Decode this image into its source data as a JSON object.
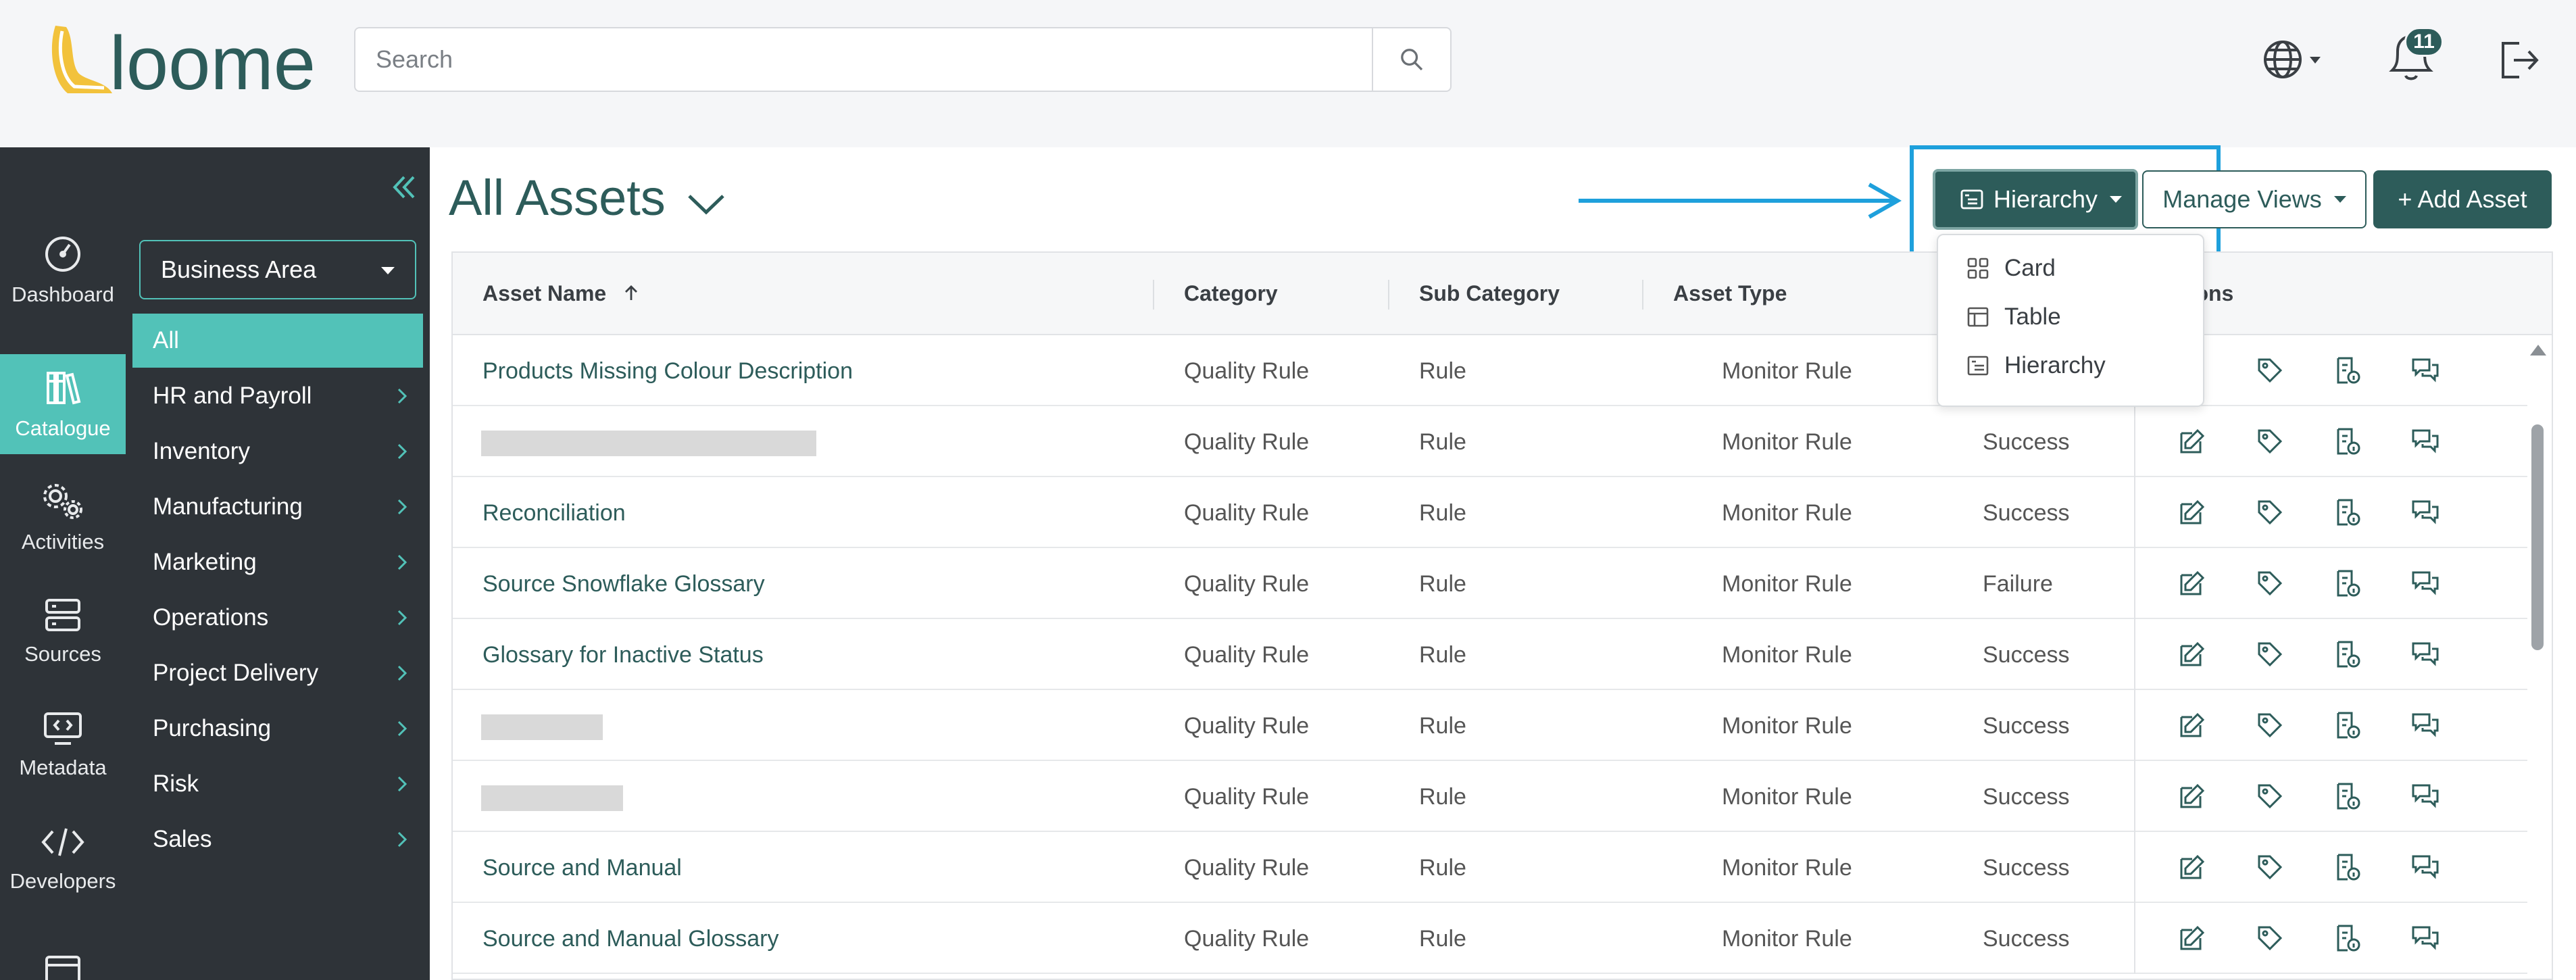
{
  "app": {
    "brand": "loome"
  },
  "header": {
    "search_placeholder": "Search",
    "notification_count": "11"
  },
  "leftnav": [
    {
      "label": "Dashboard",
      "icon": "gauge-icon"
    },
    {
      "label": "Catalogue",
      "icon": "books-icon",
      "active": true
    },
    {
      "label": "Activities",
      "icon": "gears-icon"
    },
    {
      "label": "Sources",
      "icon": "server-icon"
    },
    {
      "label": "Metadata",
      "icon": "monitor-code-icon"
    },
    {
      "label": "Developers",
      "icon": "code-icon"
    }
  ],
  "subpanel": {
    "select_label": "Business Area",
    "items": [
      "All",
      "HR and Payroll",
      "Inventory",
      "Manufacturing",
      "Marketing",
      "Operations",
      "Project Delivery",
      "Purchasing",
      "Risk",
      "Sales"
    ]
  },
  "main": {
    "title": "All Assets",
    "view_button": "Hierarchy",
    "manage_views": "Manage Views",
    "add_asset": "+ Add Asset",
    "dropdown": [
      "Card",
      "Table",
      "Hierarchy"
    ]
  },
  "table": {
    "headers": [
      "Asset Name",
      "Category",
      "Sub Category",
      "Asset Type",
      "Actions"
    ],
    "rows": [
      {
        "name": "Products Missing Colour Description",
        "category": "Quality Rule",
        "sub": "Rule",
        "type": "Monitor Rule",
        "status": ""
      },
      {
        "name": "",
        "category": "Quality Rule",
        "sub": "Rule",
        "type": "Monitor Rule",
        "status": "Success"
      },
      {
        "name": "Reconciliation",
        "category": "Quality Rule",
        "sub": "Rule",
        "type": "Monitor Rule",
        "status": "Success"
      },
      {
        "name": "Source Snowflake Glossary",
        "category": "Quality Rule",
        "sub": "Rule",
        "type": "Monitor Rule",
        "status": "Failure"
      },
      {
        "name": "Glossary for Inactive Status",
        "category": "Quality Rule",
        "sub": "Rule",
        "type": "Monitor Rule",
        "status": "Success"
      },
      {
        "name": "",
        "category": "Quality Rule",
        "sub": "Rule",
        "type": "Monitor Rule",
        "status": "Success"
      },
      {
        "name": "",
        "category": "Quality Rule",
        "sub": "Rule",
        "type": "Monitor Rule",
        "status": "Success"
      },
      {
        "name": "Source and Manual",
        "category": "Quality Rule",
        "sub": "Rule",
        "type": "Monitor Rule",
        "status": "Success"
      },
      {
        "name": "Source and Manual Glossary",
        "category": "Quality Rule",
        "sub": "Rule",
        "type": "Monitor Rule",
        "status": "Success"
      }
    ]
  },
  "colors": {
    "accent": "#52c2b8",
    "brand": "#2d5c5a",
    "highlight": "#1ea0dc",
    "nav_bg": "#2e3338"
  }
}
